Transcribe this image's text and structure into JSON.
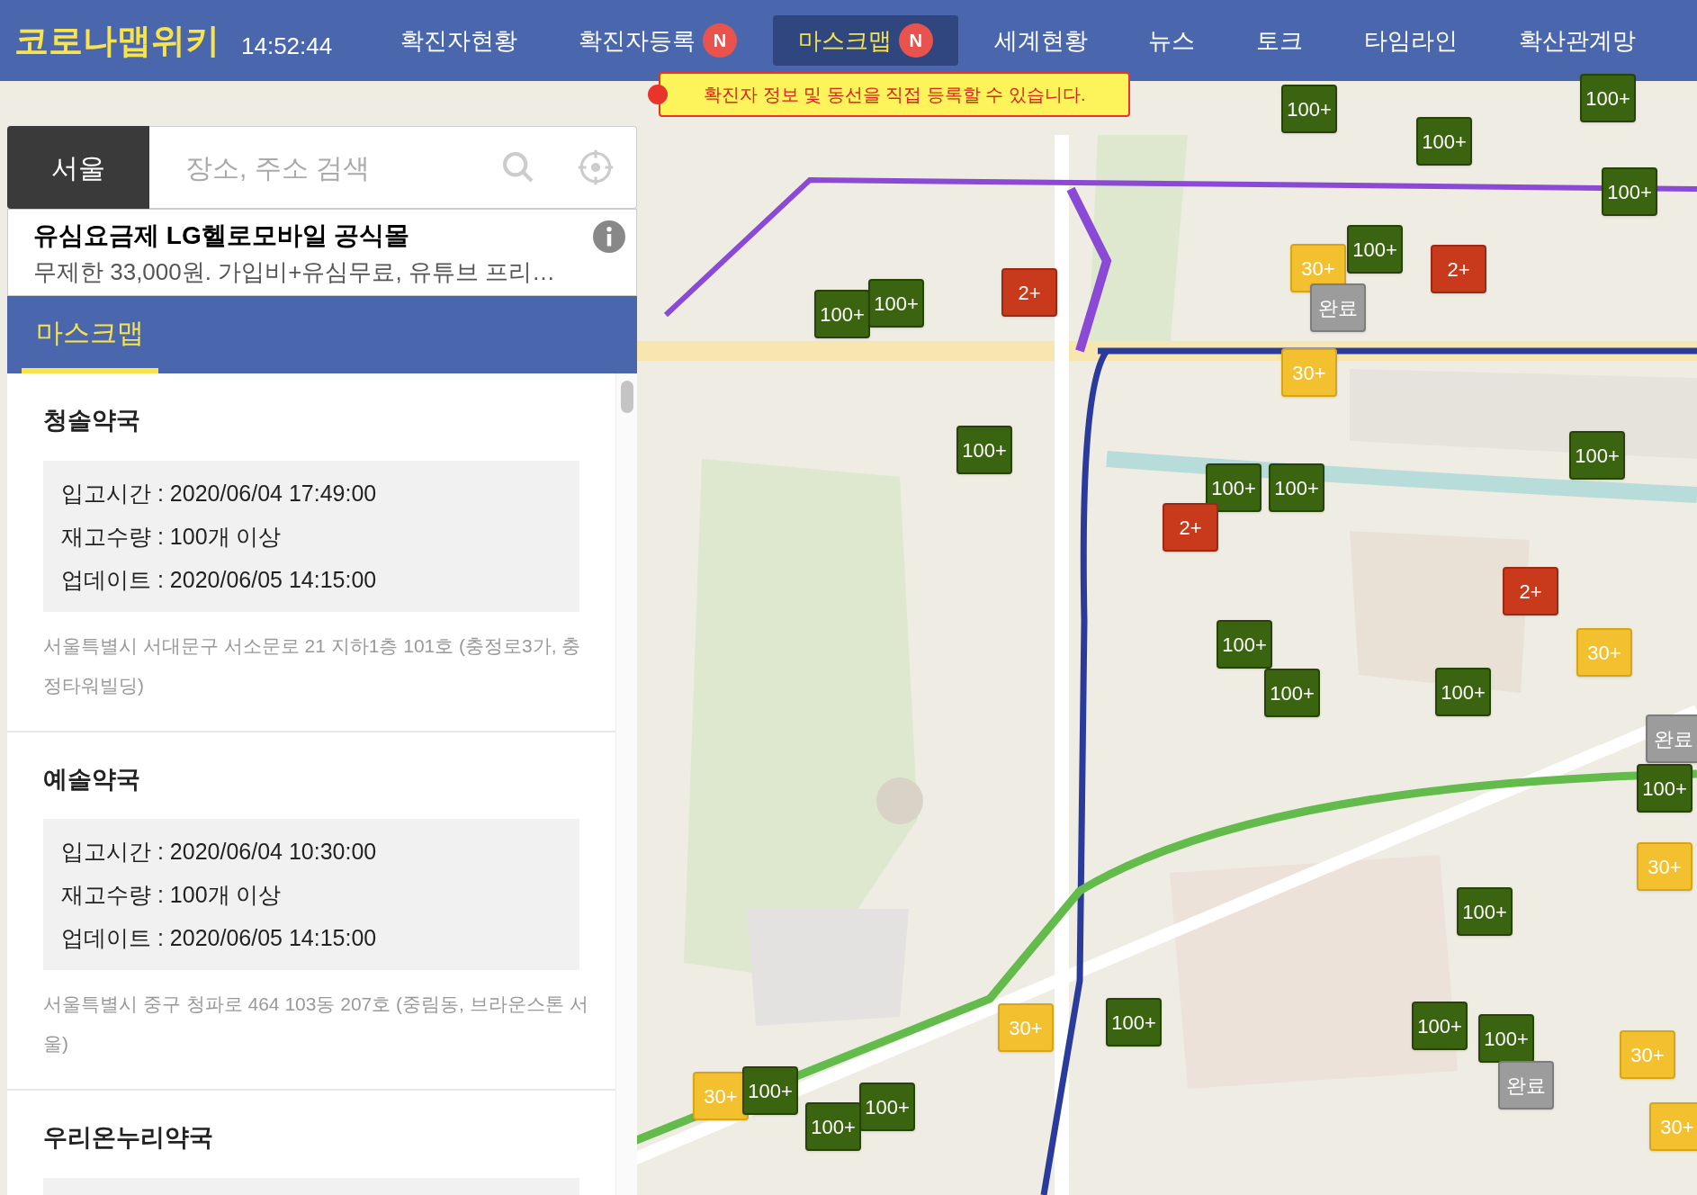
{
  "header": {
    "logo": "코로나맵위키",
    "clock": "14:52:44",
    "nav": [
      {
        "label": "확진자현황",
        "selected": false
      },
      {
        "label": "확진자등록",
        "selected": false,
        "badge": "N"
      },
      {
        "label": "마스크맵",
        "selected": true,
        "badge": "N"
      },
      {
        "label": "세계현황",
        "selected": false
      },
      {
        "label": "뉴스",
        "selected": false
      },
      {
        "label": "토크",
        "selected": false
      },
      {
        "label": "타임라인",
        "selected": false
      },
      {
        "label": "확산관계망",
        "selected": false
      }
    ]
  },
  "notice": "확진자 정보 및 동선을 직접 등록할 수 있습니다.",
  "sidebar": {
    "region_button": "서울",
    "search": {
      "placeholder": "장소, 주소 검색"
    },
    "ad": {
      "title": "유심요금제 LG헬로모바일 공식몰",
      "text": "무제한 33,000원. 가입비+유심무료, 유튜브 프리…"
    },
    "tabs": [
      {
        "label": "마스크맵",
        "selected": true
      }
    ],
    "pharmacies": [
      {
        "name": "청솔약국",
        "details": [
          "입고시간 : 2020/06/04 17:49:00",
          "재고수량 : 100개 이상",
          "업데이트 : 2020/06/05 14:15:00"
        ],
        "address": "서울특별시 서대문구 서소문로 21 지하1층 101호 (충정로3가, 충정타워빌딩)"
      },
      {
        "name": "예솔약국",
        "details": [
          "입고시간 : 2020/06/04 10:30:00",
          "재고수량 : 100개 이상",
          "업데이트 : 2020/06/05 14:15:00"
        ],
        "address": "서울특별시 중구 청파로 464 103동 207호 (중림동, 브라운스톤 서울)"
      },
      {
        "name": "우리온누리약국"
      }
    ]
  },
  "map": {
    "markers": [
      {
        "label": "100+",
        "kind": "plenty"
      },
      {
        "label": "100+",
        "kind": "plenty"
      },
      {
        "label": "100+",
        "kind": "plenty"
      },
      {
        "label": "100+",
        "kind": "plenty"
      },
      {
        "label": "100+",
        "kind": "plenty"
      },
      {
        "label": "30+",
        "kind": "some"
      },
      {
        "label": "2+",
        "kind": "few"
      },
      {
        "label": "완료",
        "kind": "empty"
      },
      {
        "label": "30+",
        "kind": "some"
      },
      {
        "label": "2+",
        "kind": "few"
      },
      {
        "label": "100+",
        "kind": "plenty"
      },
      {
        "label": "100+",
        "kind": "plenty"
      },
      {
        "label": "100+",
        "kind": "plenty"
      },
      {
        "label": "100+",
        "kind": "plenty"
      },
      {
        "label": "100+",
        "kind": "plenty"
      },
      {
        "label": "2+",
        "kind": "few"
      },
      {
        "label": "100+",
        "kind": "plenty"
      },
      {
        "label": "2+",
        "kind": "few"
      },
      {
        "label": "30+",
        "kind": "some"
      },
      {
        "label": "100+",
        "kind": "plenty"
      },
      {
        "label": "100+",
        "kind": "plenty"
      },
      {
        "label": "100+",
        "kind": "plenty"
      },
      {
        "label": "완료",
        "kind": "empty"
      },
      {
        "label": "100+",
        "kind": "plenty"
      },
      {
        "label": "30+",
        "kind": "some"
      },
      {
        "label": "100+",
        "kind": "plenty"
      },
      {
        "label": "100+",
        "kind": "plenty"
      },
      {
        "label": "100+",
        "kind": "plenty"
      },
      {
        "label": "30+",
        "kind": "some"
      },
      {
        "label": "완료",
        "kind": "empty"
      },
      {
        "label": "30+",
        "kind": "some"
      },
      {
        "label": "30+",
        "kind": "some"
      },
      {
        "label": "100+",
        "kind": "plenty"
      },
      {
        "label": "30+",
        "kind": "some"
      },
      {
        "label": "100+",
        "kind": "plenty"
      },
      {
        "label": "100+",
        "kind": "plenty"
      },
      {
        "label": "100+",
        "kind": "plenty"
      }
    ]
  }
}
